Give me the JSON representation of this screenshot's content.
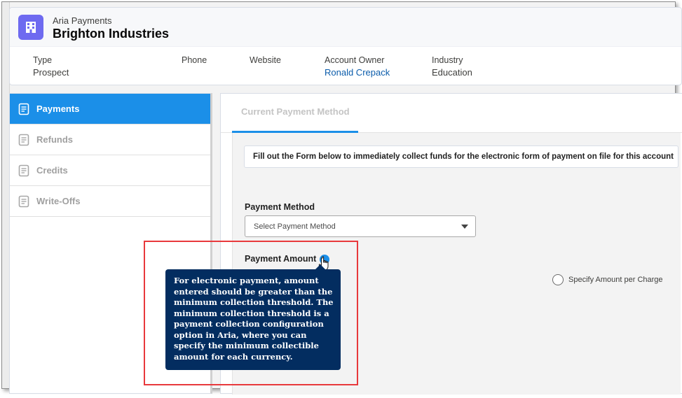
{
  "header": {
    "app_name": "Aria Payments",
    "account_name": "Brighton Industries",
    "app_icon": "building-icon",
    "fields": [
      {
        "label": "Type",
        "value": "Prospect"
      },
      {
        "label": "Phone",
        "value": ""
      },
      {
        "label": "Website",
        "value": ""
      },
      {
        "label": "Account Owner",
        "value": "Ronald Crepack"
      },
      {
        "label": "Industry",
        "value": "Education"
      }
    ]
  },
  "sidebar": {
    "items": [
      {
        "label": "Payments",
        "icon": "document-icon",
        "active": true
      },
      {
        "label": "Refunds",
        "icon": "document-icon",
        "active": false
      },
      {
        "label": "Credits",
        "icon": "document-icon",
        "active": false
      },
      {
        "label": "Write-Offs",
        "icon": "document-icon",
        "active": false
      }
    ]
  },
  "main": {
    "tab_label": "Current Payment Method",
    "info_text": "Fill out the Form below to immediately collect funds for the electronic form of payment on file for this account",
    "payment_method_label": "Payment Method",
    "payment_method_placeholder": "Select Payment Method",
    "payment_amount_label": "Payment Amount",
    "radio_label": "Specify Amount per Charge",
    "tooltip_text": "For electronic payment, amount entered should be greater than the minimum collection threshold. The minimum collection threshold is a payment collection configuration option in Aria, where you can specify the minimum collectible amount for each currency."
  },
  "colors": {
    "accent": "#1b8fe8",
    "app_icon_bg": "#6e6af0",
    "tooltip_bg": "#032d60",
    "link": "#0b5cab",
    "highlight": "#e8393c"
  }
}
